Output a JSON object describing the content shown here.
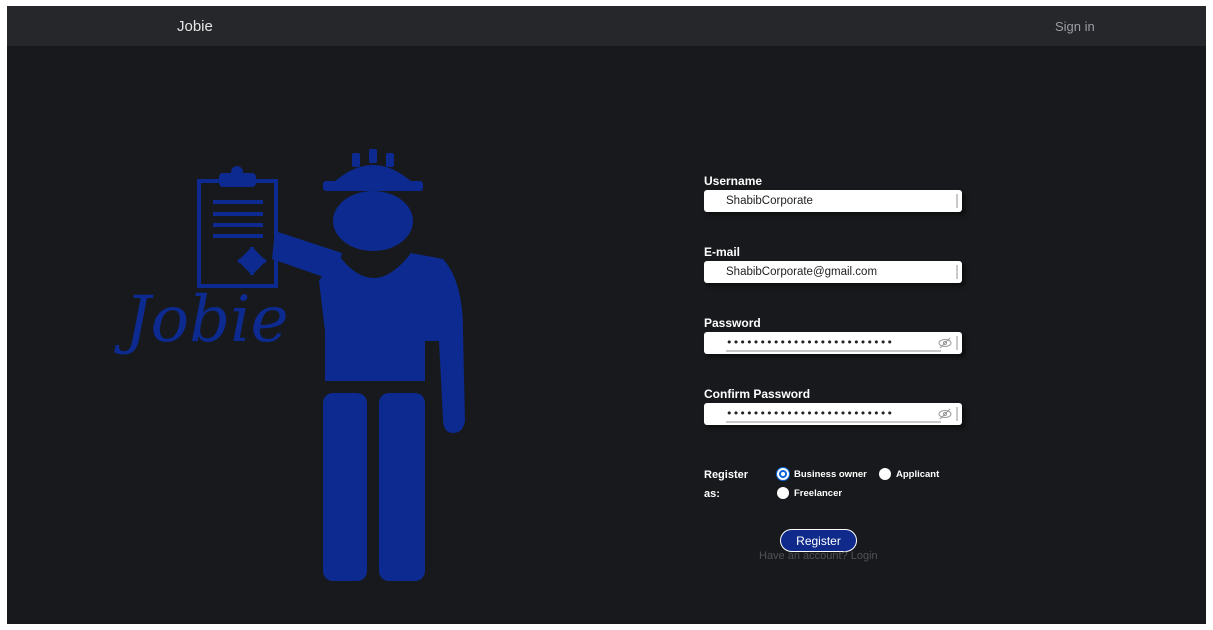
{
  "navbar": {
    "brand": "Jobie",
    "signin_label": "Sign in"
  },
  "hero": {
    "logo_text": "Jobie",
    "accent_color": "#0c2a8f"
  },
  "form": {
    "username": {
      "label": "Username",
      "value": "ShabibCorporate"
    },
    "email": {
      "label": "E-mail",
      "value": "ShabibCorporate@gmail.com"
    },
    "password": {
      "label": "Password",
      "masked_value": "•••••••••••••••••••••••••"
    },
    "confirm_password": {
      "label": "Confirm Password",
      "masked_value": "•••••••••••••••••••••••••"
    },
    "register_as": {
      "label_line1": "Register",
      "label_line2": "as:",
      "options": [
        {
          "label": "Business owner",
          "checked": true
        },
        {
          "label": "Applicant",
          "checked": false
        },
        {
          "label": "Freelancer",
          "checked": false
        }
      ]
    },
    "register_button": "Register",
    "login_prompt": "Have an account? Login"
  }
}
